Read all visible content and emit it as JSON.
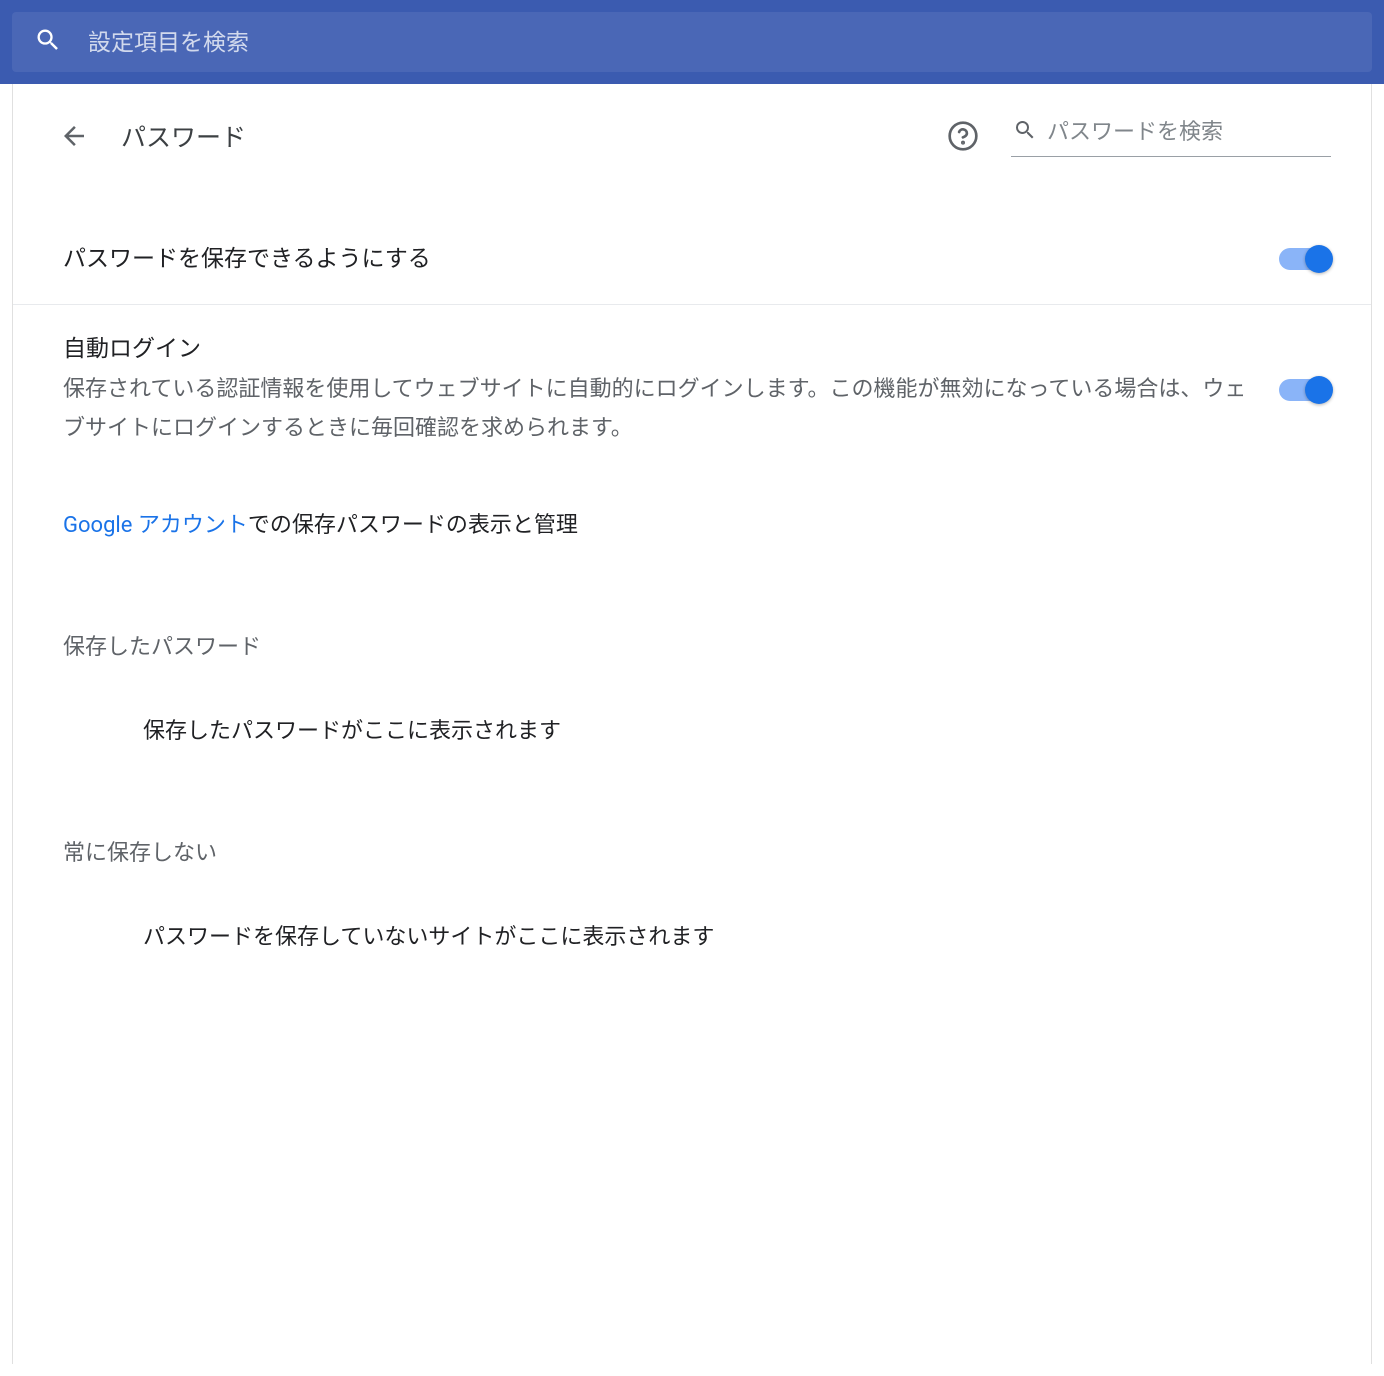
{
  "topSearch": {
    "placeholder": "設定項目を検索"
  },
  "header": {
    "title": "パスワード",
    "pwSearchPlaceholder": "パスワードを検索"
  },
  "settings": {
    "offerSave": {
      "title": "パスワードを保存できるようにする",
      "on": true
    },
    "autoSignin": {
      "title": "自動ログイン",
      "desc": "保存されている認証情報を使用してウェブサイトに自動的にログインします。この機能が無効になっている場合は、ウェブサイトにログインするときに毎回確認を求められます。",
      "on": true
    }
  },
  "accountLink": {
    "linkText": "Google アカウント",
    "trailing": "での保存パスワードの表示と管理"
  },
  "sections": {
    "saved": {
      "header": "保存したパスワード",
      "empty": "保存したパスワードがここに表示されます"
    },
    "neverSaved": {
      "header": "常に保存しない",
      "empty": "パスワードを保存していないサイトがここに表示されます"
    }
  }
}
